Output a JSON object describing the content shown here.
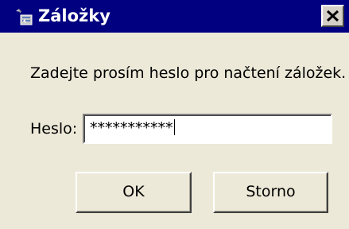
{
  "window": {
    "title": "Záložky",
    "icon": "bookmarks-icon",
    "close_icon": "close-icon"
  },
  "dialog": {
    "message": "Zadejte prosím heslo pro načtení záložek.",
    "password_label": "Heslo:",
    "password_value": "***********"
  },
  "buttons": {
    "ok_label": "OK",
    "cancel_label": "Storno"
  },
  "colors": {
    "titlebar": "#000080",
    "title_text": "#ffffff",
    "dialog_background": "#ece9d8"
  }
}
